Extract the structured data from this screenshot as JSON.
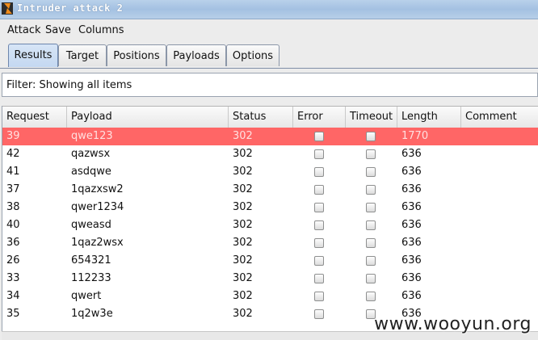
{
  "window": {
    "title": "Intruder attack 2"
  },
  "menu": [
    "Attack",
    "Save",
    "Columns"
  ],
  "tabs": [
    {
      "label": "Results",
      "active": true
    },
    {
      "label": "Target",
      "active": false
    },
    {
      "label": "Positions",
      "active": false
    },
    {
      "label": "Payloads",
      "active": false
    },
    {
      "label": "Options",
      "active": false
    }
  ],
  "filter": {
    "text": "Filter: Showing all items"
  },
  "table": {
    "columns": [
      "Request",
      "Payload",
      "Status",
      "Error",
      "Timeout",
      "Length",
      "Comment"
    ],
    "rows": [
      {
        "request": "39",
        "payload": "qwe123",
        "status": "302",
        "error": false,
        "timeout": false,
        "length": "1770",
        "selected": true
      },
      {
        "request": "42",
        "payload": "qazwsx",
        "status": "302",
        "error": false,
        "timeout": false,
        "length": "636"
      },
      {
        "request": "41",
        "payload": "asdqwe",
        "status": "302",
        "error": false,
        "timeout": false,
        "length": "636"
      },
      {
        "request": "37",
        "payload": "1qazxsw2",
        "status": "302",
        "error": false,
        "timeout": false,
        "length": "636"
      },
      {
        "request": "38",
        "payload": "qwer1234",
        "status": "302",
        "error": false,
        "timeout": false,
        "length": "636"
      },
      {
        "request": "40",
        "payload": "qweasd",
        "status": "302",
        "error": false,
        "timeout": false,
        "length": "636"
      },
      {
        "request": "36",
        "payload": "1qaz2wsx",
        "status": "302",
        "error": false,
        "timeout": false,
        "length": "636"
      },
      {
        "request": "26",
        "payload": "654321",
        "status": "302",
        "error": false,
        "timeout": false,
        "length": "636"
      },
      {
        "request": "33",
        "payload": "112233",
        "status": "302",
        "error": false,
        "timeout": false,
        "length": "636"
      },
      {
        "request": "34",
        "payload": "qwert",
        "status": "302",
        "error": false,
        "timeout": false,
        "length": "636"
      },
      {
        "request": "35",
        "payload": "1q2w3e",
        "status": "302",
        "error": false,
        "timeout": false,
        "length": "636"
      }
    ]
  },
  "watermark": "www.wooyun.org",
  "colors": {
    "selected_row": "#ff6666",
    "titlebar": "#a4c1e2",
    "tab_active": "#c4d8f1"
  }
}
